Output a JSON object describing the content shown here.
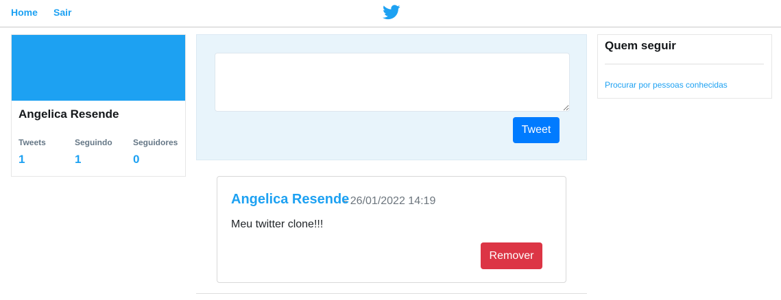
{
  "nav": {
    "home_label": "Home",
    "logout_label": "Sair",
    "logo_icon": "twitter-bird-icon",
    "brand_color": "#1da1f2"
  },
  "profile": {
    "name": "Angelica Resende",
    "banner_color": "#1da1f2",
    "stats": {
      "tweets_label": "Tweets",
      "tweets_value": "1",
      "following_label": "Seguindo",
      "following_value": "1",
      "followers_label": "Seguidores",
      "followers_value": "0"
    }
  },
  "composer": {
    "text_value": "",
    "tweet_button_label": "Tweet",
    "tweet_button_color": "#007bff"
  },
  "feed": {
    "tweets": [
      {
        "author": "Angelica Resende",
        "date": "- 26/01/2022 14:19",
        "text": "Meu twitter clone!!!",
        "remove_label": "Remover",
        "remove_color": "#dc3545"
      }
    ]
  },
  "who_to_follow": {
    "title": "Quem seguir",
    "link_label": "Procurar por pessoas conhecidas"
  }
}
